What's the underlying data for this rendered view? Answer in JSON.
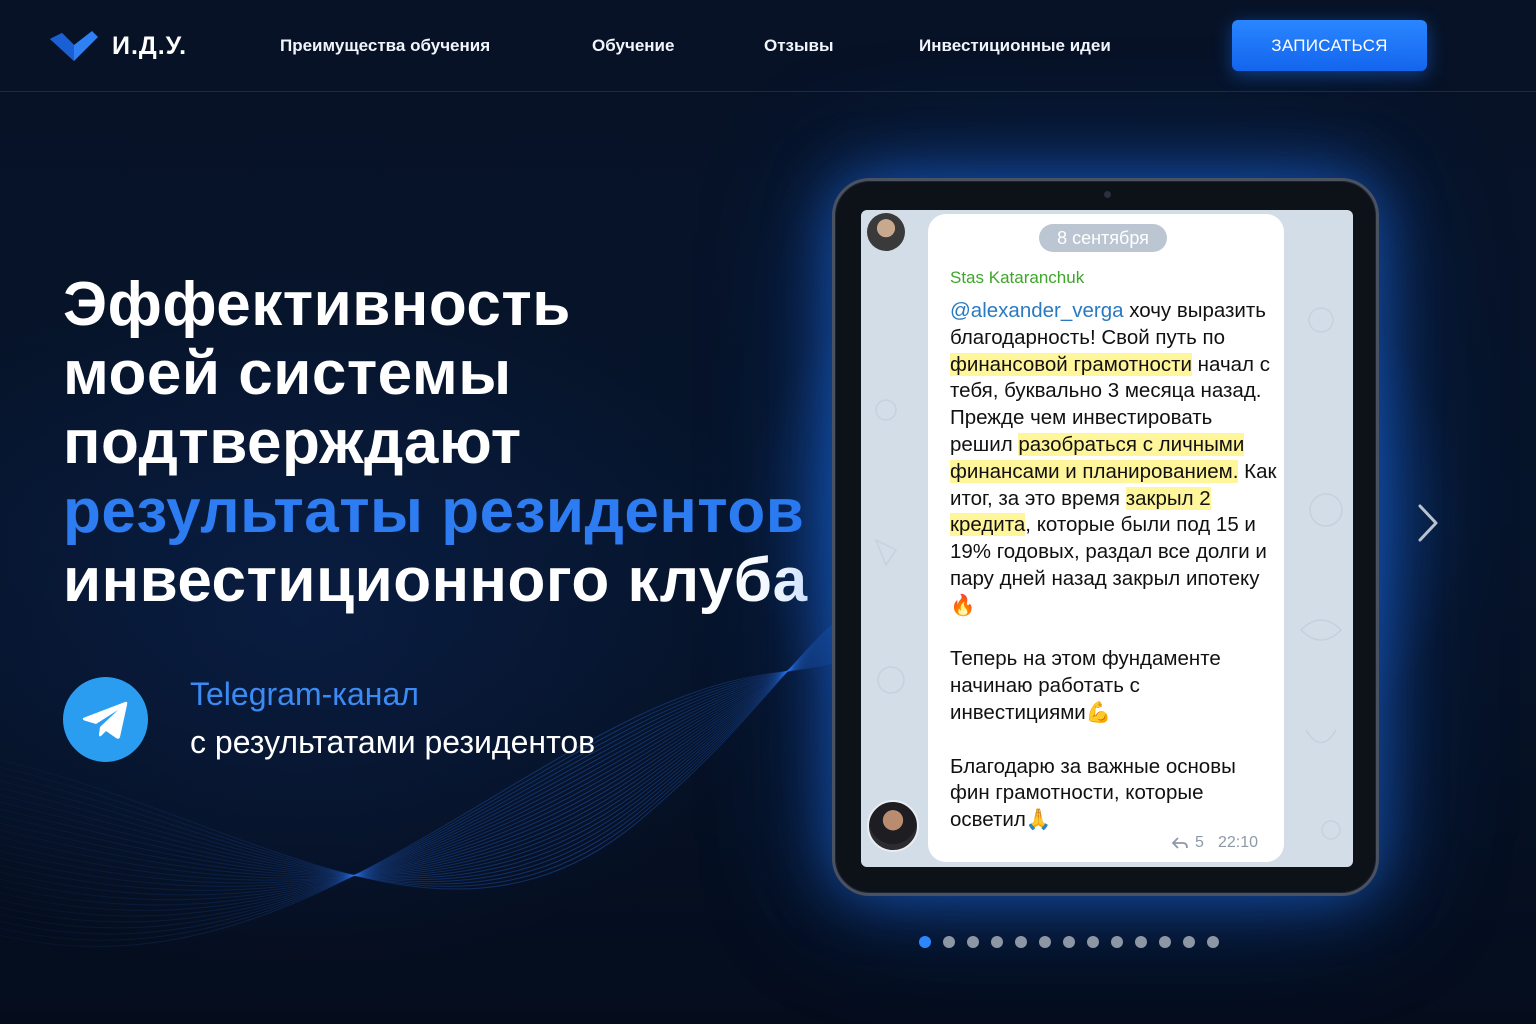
{
  "header": {
    "logo_text": "И.Д.У.",
    "nav": [
      {
        "label": "Преимущества обучения"
      },
      {
        "label": "Обучение"
      },
      {
        "label": "Отзывы"
      },
      {
        "label": "Инвестиционные идеи"
      }
    ],
    "cta_label": "ЗАПИСАТЬСЯ"
  },
  "hero": {
    "headline_lines": [
      "Эффективность",
      "моей системы",
      "подтверждают",
      "результаты резидентов",
      "инвестиционного клуба"
    ],
    "accent_line_index": 3,
    "telegram": {
      "title": "Telegram-канал",
      "subtitle": "с результатами резидентов",
      "icon": "telegram-icon"
    }
  },
  "review_slide": {
    "date": "8 сентября",
    "sender": "Stas Kataranchuk",
    "message_parts": [
      {
        "t": "@alexander_verga",
        "style": "mention"
      },
      {
        "t": " хочу выразить благодарность! Свой путь по ",
        "style": ""
      },
      {
        "t": "финансовой грамотности",
        "style": "hl"
      },
      {
        "t": " начал с тебя, буквально 3 месяца назад. Прежде чем инвестировать решил ",
        "style": ""
      },
      {
        "t": "разобраться с личными финансами и планированием.",
        "style": "hl"
      },
      {
        "t": " Как итог, за это время ",
        "style": ""
      },
      {
        "t": "закрыл 2 кредита",
        "style": "hl"
      },
      {
        "t": ", которые были под 15 и 19% годовых, раздал все долги и пару дней назад закрыл ипотеку 🔥\n\nТеперь на этом фундаменте начинаю работать с инвестициями💪\n\nБлагодарю за важные основы фин грамотности, которые осветил🙏",
        "style": ""
      }
    ],
    "replies": "5",
    "time": "22:10"
  },
  "carousel": {
    "total": 13,
    "active_index": 0
  },
  "colors": {
    "accent": "#2d7cf1",
    "cta": "#1a72f5",
    "highlight": "#fff59a",
    "sender": "#3ea62a"
  }
}
